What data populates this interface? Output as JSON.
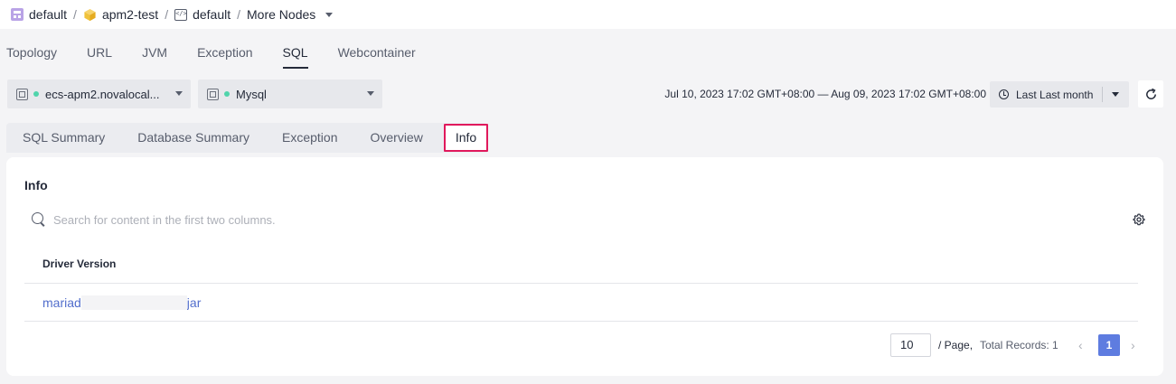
{
  "breadcrumb": {
    "items": [
      {
        "label": "default",
        "icon": "app-grid-icon"
      },
      {
        "label": "apm2-test",
        "icon": "cube-icon"
      },
      {
        "label": "default",
        "icon": "code-window-icon"
      }
    ],
    "more_nodes": "More Nodes",
    "separator": "/"
  },
  "main_tabs": [
    "Topology",
    "URL",
    "JVM",
    "Exception",
    "SQL",
    "Webcontainer"
  ],
  "main_tab_active": "SQL",
  "instance_select": {
    "value": "ecs-apm2.novalocal...",
    "status_color": "#50d4ab"
  },
  "database_select": {
    "value": "Mysql",
    "status_color": "#50d4ab"
  },
  "time_range": "Jul 10, 2023 17:02 GMT+08:00 — Aug 09, 2023 17:02 GMT+08:00",
  "time_preset": "Last Last month",
  "sub_tabs": [
    "SQL Summary",
    "Database Summary",
    "Exception",
    "Overview",
    "Info"
  ],
  "sub_tab_active": "Info",
  "panel": {
    "title": "Info",
    "search_placeholder": "Search for content in the first two columns.",
    "columns": [
      "Driver Version"
    ],
    "rows": [
      {
        "driver_version_start": "mariad",
        "driver_version_end": "jar"
      }
    ]
  },
  "pagination": {
    "page_size": "10",
    "page_label": "/ Page,",
    "total_records": "Total Records: 1",
    "current_page": "1",
    "prev": "‹",
    "next": "›"
  },
  "colors": {
    "accent": "#5e7ce0",
    "highlight_border": "#e0195c",
    "link": "#526ecc",
    "status_dot": "#50d4ab"
  }
}
